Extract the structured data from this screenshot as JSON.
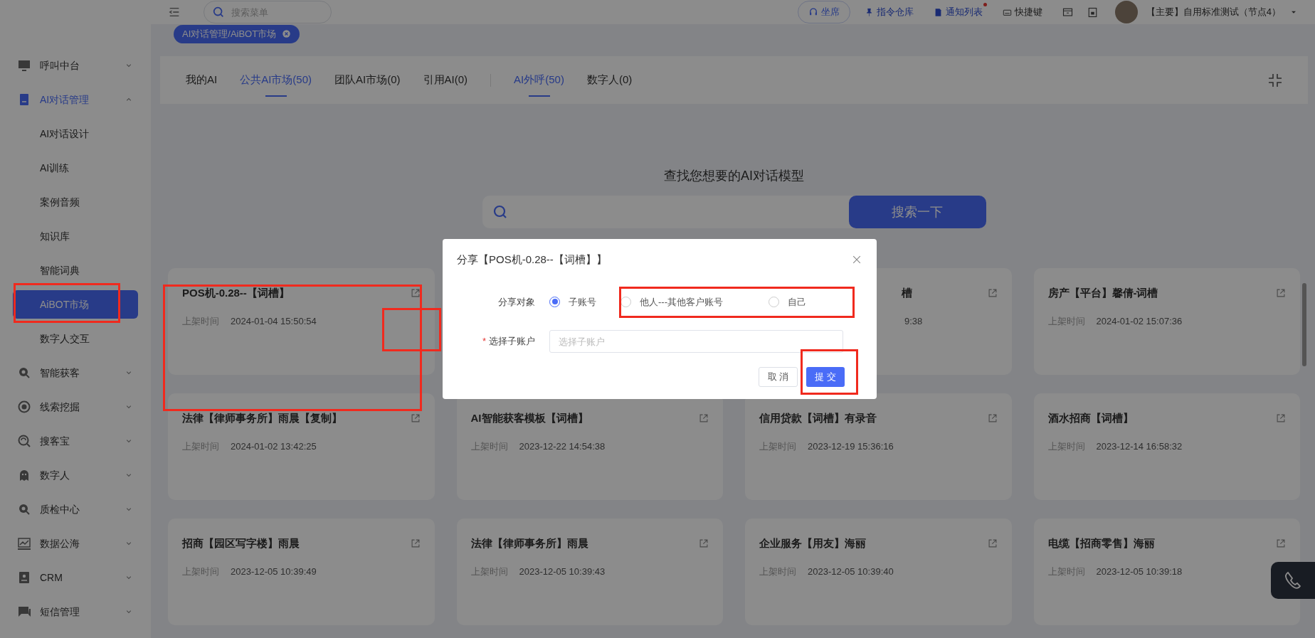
{
  "topbar": {
    "search": {
      "placeholder": "搜索菜单"
    },
    "seat_button": "坐席",
    "links": [
      {
        "label": "指令仓库",
        "dot": false
      },
      {
        "label": "通知列表",
        "dot": true
      },
      {
        "label": "快捷键",
        "dot": false
      }
    ],
    "account": "【主要】自用标准测试（节点4）"
  },
  "breadcrumb_tag": "AI对话管理/AiBOT市场",
  "sidebar": {
    "items": [
      {
        "label": "呼叫中台",
        "expanded": false
      },
      {
        "label": "AI对话管理",
        "expanded": true,
        "children": [
          {
            "label": "AI对话设计",
            "selected": false
          },
          {
            "label": "AI训练",
            "selected": false
          },
          {
            "label": "案例音频",
            "selected": false
          },
          {
            "label": "知识库",
            "selected": false
          },
          {
            "label": "智能词典",
            "selected": false
          },
          {
            "label": "AiBOT市场",
            "selected": true
          },
          {
            "label": "数字人交互",
            "selected": false
          }
        ]
      },
      {
        "label": "智能获客",
        "expanded": false
      },
      {
        "label": "线索挖掘",
        "expanded": false
      },
      {
        "label": "搜客宝",
        "expanded": false
      },
      {
        "label": "数字人",
        "expanded": false
      },
      {
        "label": "质检中心",
        "expanded": false
      },
      {
        "label": "数据公海",
        "expanded": false
      },
      {
        "label": "CRM",
        "expanded": false
      },
      {
        "label": "短信管理",
        "expanded": false
      }
    ]
  },
  "tab_groups": [
    [
      {
        "label": "我的AI",
        "selected": false
      },
      {
        "label": "公共AI市场(50)",
        "selected": true
      },
      {
        "label": "团队AI市场(0)",
        "selected": false
      },
      {
        "label": "引用AI(0)",
        "selected": false
      }
    ],
    [
      {
        "label": "AI外呼(50)",
        "selected": true
      },
      {
        "label": "数字人(0)",
        "selected": false
      }
    ]
  ],
  "search_title": "查找您想要的AI对话模型",
  "search_button": "搜索一下",
  "cards": [
    {
      "kind": "full",
      "title": "POS机-0.28--【词槽】",
      "time_label": "上架时间",
      "time": "2024-01-04 15:50:54"
    },
    {
      "kind": "blank"
    },
    {
      "kind": "clipped",
      "title": "槽",
      "time": "9:38"
    },
    {
      "kind": "full",
      "title": "房产【平台】馨倩-词槽",
      "time_label": "上架时间",
      "time": "2024-01-02 15:07:36"
    },
    {
      "kind": "full",
      "title": "法律【律师事务所】雨晨【复制】",
      "time_label": "上架时间",
      "time": "2024-01-02 13:42:25"
    },
    {
      "kind": "full",
      "title": "AI智能获客模板【词槽】",
      "time_label": "上架时间",
      "time": "2023-12-22 14:54:38"
    },
    {
      "kind": "full",
      "title": "信用贷款【词槽】有录音",
      "time_label": "上架时间",
      "time": "2023-12-19 15:36:16"
    },
    {
      "kind": "full",
      "title": "酒水招商【词槽】",
      "time_label": "上架时间",
      "time": "2023-12-14 16:58:32"
    },
    {
      "kind": "full",
      "title": "招商【园区写字楼】雨晨",
      "time_label": "上架时间",
      "time": "2023-12-05 10:39:49"
    },
    {
      "kind": "full",
      "title": "法律【律师事务所】雨晨",
      "time_label": "上架时间",
      "time": "2023-12-05 10:39:43"
    },
    {
      "kind": "full",
      "title": "企业服务【用友】海丽",
      "time_label": "上架时间",
      "time": "2023-12-05 10:39:40"
    },
    {
      "kind": "full",
      "title": "电缆【招商零售】海丽",
      "time_label": "上架时间",
      "time": "2023-12-05 10:39:18"
    },
    {
      "kind": "blank"
    },
    {
      "kind": "blank"
    },
    {
      "kind": "blank"
    },
    {
      "kind": "blank"
    }
  ],
  "dialog": {
    "title": "分享【POS机-0.28--【词槽】】",
    "target_label": "分享对象",
    "options": [
      {
        "label": "子账号",
        "selected": true
      },
      {
        "label": "他人---其他客户账号",
        "selected": false
      },
      {
        "label": "自己",
        "selected": false
      }
    ],
    "account_label": "选择子账户",
    "required_mark": "*",
    "account_placeholder": "选择子账户",
    "cancel": "取 消",
    "submit": "提 交"
  }
}
